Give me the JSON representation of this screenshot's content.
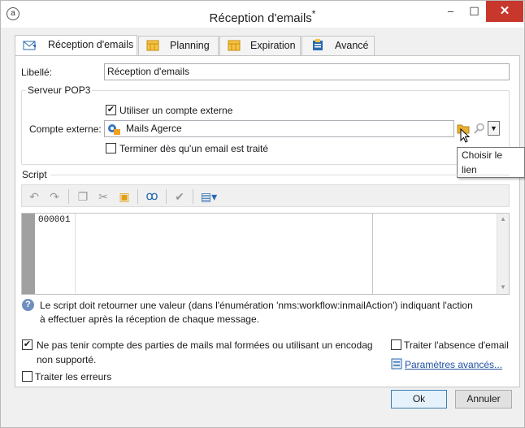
{
  "window": {
    "title": "Réception d'emails",
    "modified_marker": "*",
    "minimize": "–",
    "maximize": "☐",
    "close": "✕"
  },
  "tabs": [
    {
      "label": "Réception d'emails",
      "active": true
    },
    {
      "label": "Planning",
      "active": false
    },
    {
      "label": "Expiration",
      "active": false
    },
    {
      "label": "Avancé",
      "active": false
    }
  ],
  "form": {
    "label_libelle": "Libellé:",
    "libelle_value": "Réception d'emails"
  },
  "pop3": {
    "group_title": "Serveur POP3",
    "use_external_label": "Utiliser un compte externe",
    "use_external_checked": "✔",
    "account_label": "Compte externe:",
    "account_value": "Mails Agerce",
    "stop_label": "Terminer dès qu'un email est traité",
    "tooltip": "Choisir le lien"
  },
  "script": {
    "group_title": "Script",
    "line_number": "000001",
    "help_text_1": "Le script doit retourner une valeur (dans l'énumération 'nms:workflow:inmailAction') indiquant l'action",
    "help_text_2": "à effectuer après la réception de  chaque message."
  },
  "options": {
    "ignore_malformed_label_1": "Ne pas tenir compte des parties de mails mal formées ou utilisant un encodag",
    "ignore_malformed_label_2": "non supporté.",
    "ignore_malformed_checked": "✔",
    "handle_errors_label": "Traiter les erreurs",
    "handle_absence_label": "Traiter l'absence d'email",
    "advanced_link": "Paramètres avancés..."
  },
  "buttons": {
    "ok": "Ok",
    "cancel": "Annuler"
  },
  "colors": {
    "accent": "#1f4fa0",
    "close": "#c7372c",
    "tab_icon": "#e8a317"
  }
}
